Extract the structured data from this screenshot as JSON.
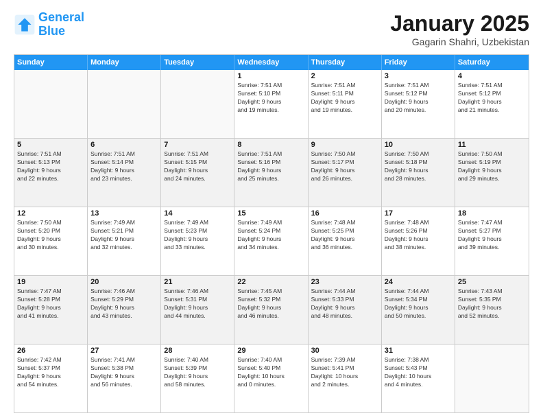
{
  "header": {
    "logo_line1": "General",
    "logo_line2": "Blue",
    "month_year": "January 2025",
    "location": "Gagarin Shahri, Uzbekistan"
  },
  "weekdays": [
    "Sunday",
    "Monday",
    "Tuesday",
    "Wednesday",
    "Thursday",
    "Friday",
    "Saturday"
  ],
  "rows": [
    [
      {
        "day": "",
        "info": ""
      },
      {
        "day": "",
        "info": ""
      },
      {
        "day": "",
        "info": ""
      },
      {
        "day": "1",
        "info": "Sunrise: 7:51 AM\nSunset: 5:10 PM\nDaylight: 9 hours\nand 19 minutes."
      },
      {
        "day": "2",
        "info": "Sunrise: 7:51 AM\nSunset: 5:11 PM\nDaylight: 9 hours\nand 19 minutes."
      },
      {
        "day": "3",
        "info": "Sunrise: 7:51 AM\nSunset: 5:12 PM\nDaylight: 9 hours\nand 20 minutes."
      },
      {
        "day": "4",
        "info": "Sunrise: 7:51 AM\nSunset: 5:12 PM\nDaylight: 9 hours\nand 21 minutes."
      }
    ],
    [
      {
        "day": "5",
        "info": "Sunrise: 7:51 AM\nSunset: 5:13 PM\nDaylight: 9 hours\nand 22 minutes."
      },
      {
        "day": "6",
        "info": "Sunrise: 7:51 AM\nSunset: 5:14 PM\nDaylight: 9 hours\nand 23 minutes."
      },
      {
        "day": "7",
        "info": "Sunrise: 7:51 AM\nSunset: 5:15 PM\nDaylight: 9 hours\nand 24 minutes."
      },
      {
        "day": "8",
        "info": "Sunrise: 7:51 AM\nSunset: 5:16 PM\nDaylight: 9 hours\nand 25 minutes."
      },
      {
        "day": "9",
        "info": "Sunrise: 7:50 AM\nSunset: 5:17 PM\nDaylight: 9 hours\nand 26 minutes."
      },
      {
        "day": "10",
        "info": "Sunrise: 7:50 AM\nSunset: 5:18 PM\nDaylight: 9 hours\nand 28 minutes."
      },
      {
        "day": "11",
        "info": "Sunrise: 7:50 AM\nSunset: 5:19 PM\nDaylight: 9 hours\nand 29 minutes."
      }
    ],
    [
      {
        "day": "12",
        "info": "Sunrise: 7:50 AM\nSunset: 5:20 PM\nDaylight: 9 hours\nand 30 minutes."
      },
      {
        "day": "13",
        "info": "Sunrise: 7:49 AM\nSunset: 5:21 PM\nDaylight: 9 hours\nand 32 minutes."
      },
      {
        "day": "14",
        "info": "Sunrise: 7:49 AM\nSunset: 5:23 PM\nDaylight: 9 hours\nand 33 minutes."
      },
      {
        "day": "15",
        "info": "Sunrise: 7:49 AM\nSunset: 5:24 PM\nDaylight: 9 hours\nand 34 minutes."
      },
      {
        "day": "16",
        "info": "Sunrise: 7:48 AM\nSunset: 5:25 PM\nDaylight: 9 hours\nand 36 minutes."
      },
      {
        "day": "17",
        "info": "Sunrise: 7:48 AM\nSunset: 5:26 PM\nDaylight: 9 hours\nand 38 minutes."
      },
      {
        "day": "18",
        "info": "Sunrise: 7:47 AM\nSunset: 5:27 PM\nDaylight: 9 hours\nand 39 minutes."
      }
    ],
    [
      {
        "day": "19",
        "info": "Sunrise: 7:47 AM\nSunset: 5:28 PM\nDaylight: 9 hours\nand 41 minutes."
      },
      {
        "day": "20",
        "info": "Sunrise: 7:46 AM\nSunset: 5:29 PM\nDaylight: 9 hours\nand 43 minutes."
      },
      {
        "day": "21",
        "info": "Sunrise: 7:46 AM\nSunset: 5:31 PM\nDaylight: 9 hours\nand 44 minutes."
      },
      {
        "day": "22",
        "info": "Sunrise: 7:45 AM\nSunset: 5:32 PM\nDaylight: 9 hours\nand 46 minutes."
      },
      {
        "day": "23",
        "info": "Sunrise: 7:44 AM\nSunset: 5:33 PM\nDaylight: 9 hours\nand 48 minutes."
      },
      {
        "day": "24",
        "info": "Sunrise: 7:44 AM\nSunset: 5:34 PM\nDaylight: 9 hours\nand 50 minutes."
      },
      {
        "day": "25",
        "info": "Sunrise: 7:43 AM\nSunset: 5:35 PM\nDaylight: 9 hours\nand 52 minutes."
      }
    ],
    [
      {
        "day": "26",
        "info": "Sunrise: 7:42 AM\nSunset: 5:37 PM\nDaylight: 9 hours\nand 54 minutes."
      },
      {
        "day": "27",
        "info": "Sunrise: 7:41 AM\nSunset: 5:38 PM\nDaylight: 9 hours\nand 56 minutes."
      },
      {
        "day": "28",
        "info": "Sunrise: 7:40 AM\nSunset: 5:39 PM\nDaylight: 9 hours\nand 58 minutes."
      },
      {
        "day": "29",
        "info": "Sunrise: 7:40 AM\nSunset: 5:40 PM\nDaylight: 10 hours\nand 0 minutes."
      },
      {
        "day": "30",
        "info": "Sunrise: 7:39 AM\nSunset: 5:41 PM\nDaylight: 10 hours\nand 2 minutes."
      },
      {
        "day": "31",
        "info": "Sunrise: 7:38 AM\nSunset: 5:43 PM\nDaylight: 10 hours\nand 4 minutes."
      },
      {
        "day": "",
        "info": ""
      }
    ]
  ],
  "accent_color": "#2196f3"
}
